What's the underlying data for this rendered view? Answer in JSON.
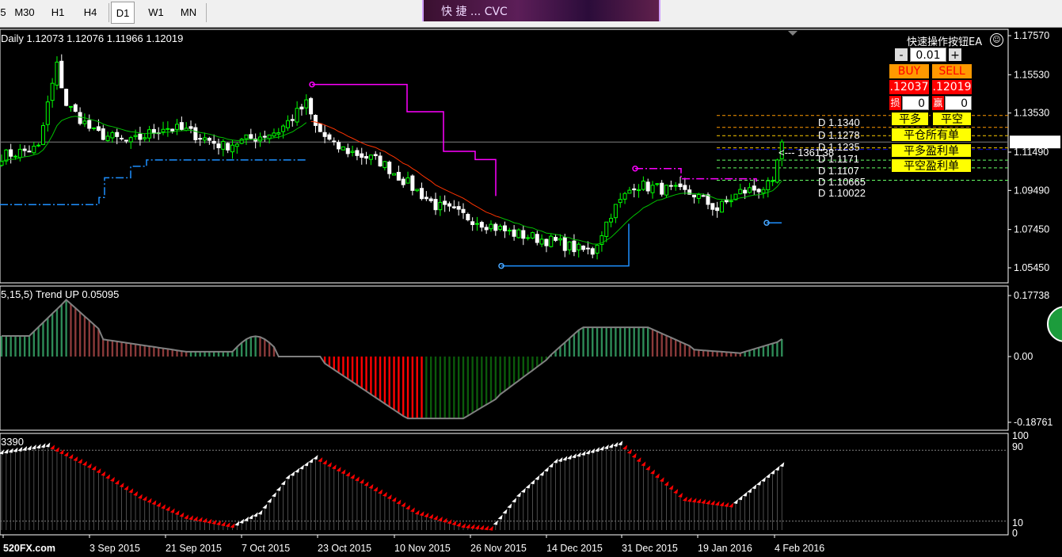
{
  "toolbar": {
    "timeframes": [
      "5",
      "M30",
      "H1",
      "H4",
      "D1",
      "W1",
      "MN"
    ],
    "active": "D1",
    "banner_text": "快 捷 ... CVC"
  },
  "price_panel": {
    "header": "Daily  1.12073 1.12076 1.11966 1.12019",
    "ea_title": "快速操作按钮EA",
    "smile_icon": "smiley-icon",
    "lot": "0.01",
    "minus": "-",
    "plus": "+",
    "buy": "BUY",
    "sell": "SELL",
    "buy_price": ".12037",
    "sell_price": ".12019",
    "loss_label": "损",
    "loss_value": "0",
    "profit_label": "赢",
    "profit_value": "0",
    "close_long": "平多",
    "close_short": "平空",
    "close_all": "平仓所有单",
    "close_long_profit": "平多盈利单",
    "close_short_profit": "平空盈利单",
    "pivot_labels": [
      "D  1.1340",
      "D  1.1278",
      "D  1.1235",
      "D  1.1171",
      "D  1.1107",
      "D  1.10665",
      "D  1.10022"
    ],
    "arrow_text": "<--- 1361'38",
    "current_price": "1.12019",
    "y_ticks": [
      "1.17570",
      "1.15530",
      "1.13530",
      "1.11490",
      "1.09490",
      "1.07450",
      "1.05450"
    ],
    "colors": {
      "bull": "#00ff00",
      "bear": "#ffffff",
      "stop_up": "#1e90ff",
      "stop_down": "#ff00ff",
      "ma_red": "#ff3300",
      "ma_green": "#00c000"
    }
  },
  "macd_panel": {
    "header": "5,15,5) Trend UP 0.05095",
    "y_ticks": [
      "0.17738",
      "0.00",
      "-0.18761"
    ],
    "colors": {
      "up": "#2e8b57",
      "down_light": "#8b3a3a",
      "down": "#ff0000",
      "line": "#808080"
    }
  },
  "stoch_panel": {
    "header": "3390",
    "y_ticks": [
      "100",
      "90",
      "10",
      "0"
    ],
    "colors": {
      "down": "#ff0000",
      "up": "#ffffff"
    }
  },
  "x_axis": {
    "labels": [
      "520FX.com",
      "3 Sep 2015",
      "21 Sep 2015",
      "7 Oct 2015",
      "23 Oct 2015",
      "10 Nov 2015",
      "26 Nov 2015",
      "14 Dec 2015",
      "31 Dec 2015",
      "19 Jan 2016",
      "4 Feb 2016"
    ]
  }
}
